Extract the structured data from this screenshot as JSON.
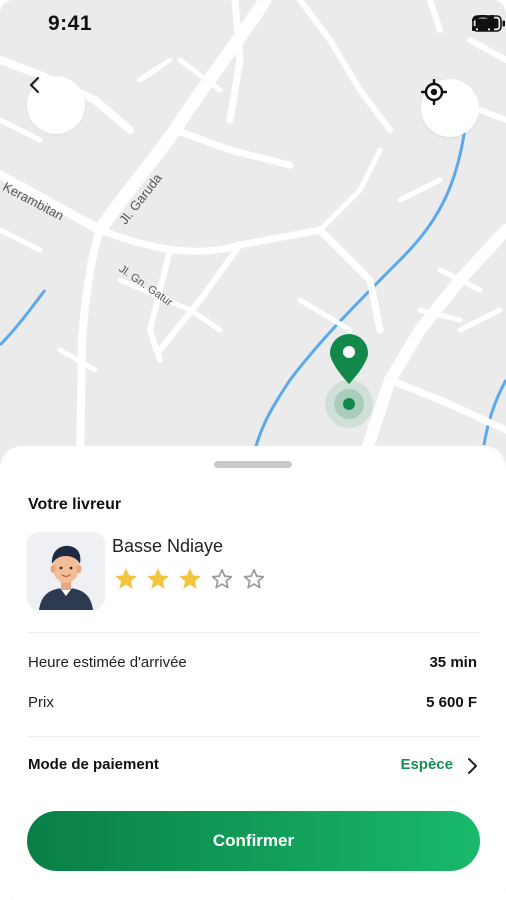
{
  "status_bar": {
    "time": "9:41"
  },
  "map": {
    "streets": [
      "Kerambitan",
      "Jl. Garuda",
      "Jl. Gn. Gatur"
    ]
  },
  "driver_section": {
    "title": "Votre livreur",
    "name": "Basse Ndiaye",
    "rating": 3,
    "rating_max": 5
  },
  "trip": {
    "eta_label": "Heure estimée d'arrivée",
    "eta_value": "35 min",
    "price_label": "Prix",
    "price_value": "5 600 F"
  },
  "payment": {
    "label": "Mode de paiement",
    "value": "Espèce"
  },
  "actions": {
    "confirm_label": "Confirmer"
  },
  "colors": {
    "accent": "#1a8f52",
    "button_start": "#0a7e46",
    "button_end": "#19b96a",
    "star_filled": "#f5c542",
    "map_water": "#5aa9ef",
    "pin": "#12894a"
  },
  "icons": [
    "back-arrow-icon",
    "locate-icon",
    "map-pin-icon",
    "signal-icon",
    "wifi-icon",
    "battery-icon",
    "star-icon",
    "chevron-right-icon"
  ]
}
